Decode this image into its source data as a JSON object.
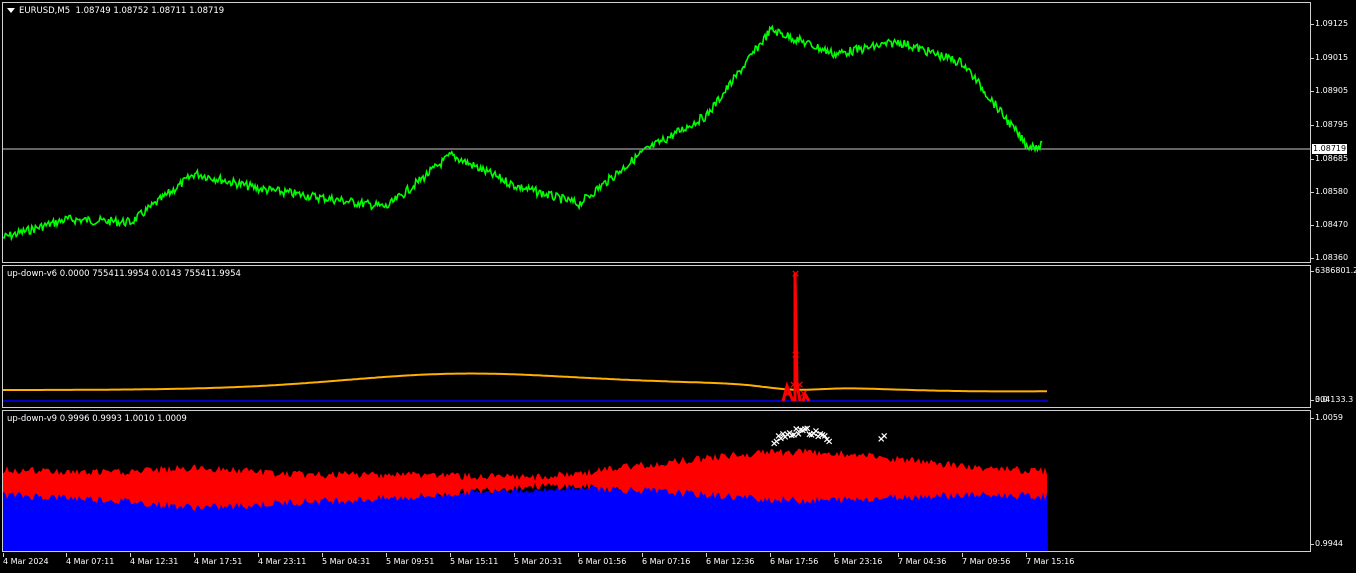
{
  "main_pane": {
    "title": "EURUSD,M5",
    "ohlc": "1.08749 1.08752 1.08711 1.08719",
    "current_price": "1.08719",
    "y_ticks": [
      "1.09125",
      "1.09015",
      "1.08905",
      "1.08795",
      "1.08685",
      "1.08580",
      "1.08470",
      "1.08360"
    ],
    "price_color": "#00ff00"
  },
  "indicator1": {
    "label": "up-down-v6 0.0000 755411.9954 0.0143 755411.9954",
    "y_top": "6386801.2",
    "y_bottom": "0.0",
    "y_bottom_overlap": "304133.3",
    "colors": {
      "main": "#ffb000",
      "spike": "#ff0000",
      "base": "#0000ff"
    }
  },
  "indicator2": {
    "label": "up-down-v9 0.9996 0.9993 1.0010 1.0009",
    "y_top": "1.0059",
    "y_bottom": "0.9944",
    "colors": {
      "upper": "#ff0000",
      "lower": "#0000ff",
      "markers": "#ffffff"
    }
  },
  "x_axis": {
    "labels": [
      "4 Mar 2024",
      "4 Mar 07:11",
      "4 Mar 12:31",
      "4 Mar 17:51",
      "4 Mar 23:11",
      "5 Mar 04:31",
      "5 Mar 09:51",
      "5 Mar 15:11",
      "5 Mar 20:31",
      "6 Mar 01:56",
      "6 Mar 07:16",
      "6 Mar 12:36",
      "6 Mar 17:56",
      "6 Mar 23:16",
      "7 Mar 04:36",
      "7 Mar 09:56",
      "7 Mar 15:16"
    ]
  },
  "chart_data": {
    "type": "line",
    "title": "EURUSD,M5",
    "xlabel": "",
    "ylabel": "",
    "ylim": [
      1.0836,
      1.09125
    ],
    "x": [
      "4 Mar 2024",
      "4 Mar 07:11",
      "4 Mar 12:31",
      "4 Mar 17:51",
      "4 Mar 23:11",
      "5 Mar 04:31",
      "5 Mar 09:51",
      "5 Mar 15:11",
      "5 Mar 20:31",
      "6 Mar 01:56",
      "6 Mar 07:16",
      "6 Mar 12:36",
      "6 Mar 17:56",
      "6 Mar 23:16",
      "7 Mar 04:36",
      "7 Mar 09:56",
      "7 Mar 15:16"
    ],
    "series": [
      {
        "name": "",
        "values": [
          1.0842,
          1.0848,
          1.0847,
          1.0863,
          1.0858,
          1.0855,
          1.0852,
          1.0869,
          1.0859,
          1.0853,
          1.087,
          1.0882,
          1.091,
          1.0902,
          1.0906,
          1.0899,
          1.0872
        ]
      }
    ],
    "grid": false
  }
}
